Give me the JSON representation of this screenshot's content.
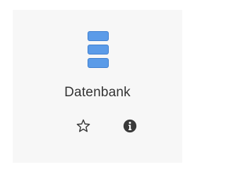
{
  "tile": {
    "label": "Datenbank",
    "icon": "database-icon",
    "colors": {
      "icon_fill": "#5b9be8",
      "icon_stroke": "#3f7fd0",
      "tile_background": "#f7f7f7",
      "text": "#333333",
      "action_icon": "#3a3a3a"
    },
    "actions": [
      {
        "name": "favorite",
        "icon": "star-outline-icon"
      },
      {
        "name": "info",
        "icon": "info-circle-icon"
      }
    ]
  }
}
